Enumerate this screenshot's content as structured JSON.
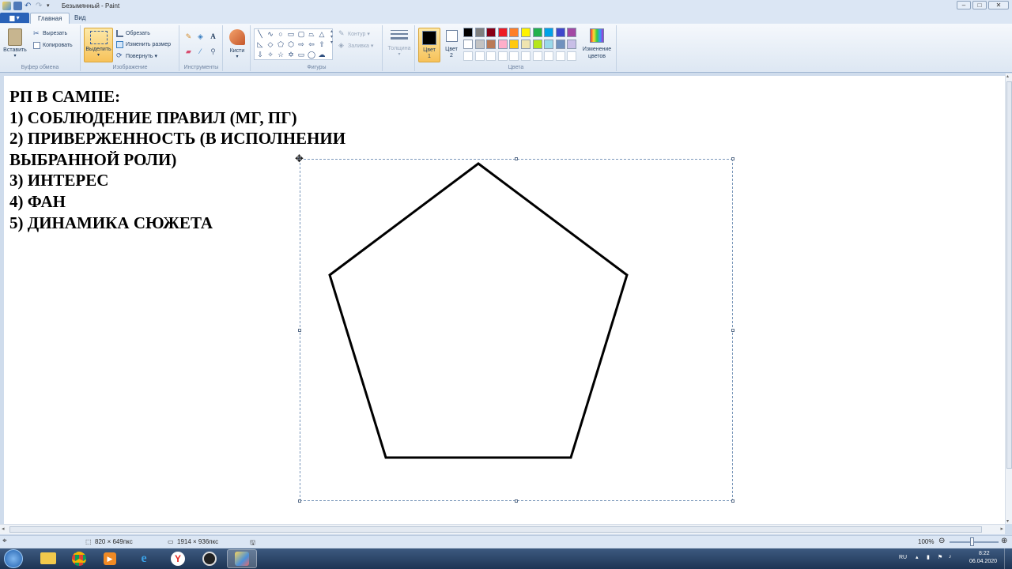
{
  "window": {
    "title": "Безымянный - Paint",
    "min": "–",
    "max": "□",
    "close": "✕"
  },
  "tabs": {
    "menu": "▆ ▾",
    "home": "Главная",
    "view": "Вид"
  },
  "clipboard": {
    "paste": "Вставить",
    "cut": "Вырезать",
    "copy": "Копировать",
    "label": "Буфер обмена"
  },
  "image": {
    "select": "Выделить",
    "crop": "Обрезать",
    "resize": "Изменить размер",
    "rotate": "Повернуть ▾",
    "label": "Изображение"
  },
  "tools": {
    "label": "Инструменты",
    "text_tool": "A"
  },
  "brushes": {
    "label": "Кисти"
  },
  "shapes": {
    "outline": "Контур ▾",
    "fill": "Заливка ▾",
    "label": "Фигуры"
  },
  "size": {
    "label": "Толщина"
  },
  "colors": {
    "color1": "Цвет 1",
    "color2": "Цвет 2",
    "edit": "Изменение цветов",
    "label": "Цвета",
    "color1_value": "#000000",
    "color2_value": "#ffffff",
    "palette_row1": [
      "#000000",
      "#7f7f7f",
      "#880015",
      "#ed1c24",
      "#ff7f27",
      "#fff200",
      "#22b14c",
      "#00a2e8",
      "#3f48cc",
      "#a349a4"
    ],
    "palette_row2": [
      "#ffffff",
      "#c3c3c3",
      "#b97a57",
      "#ffaec9",
      "#ffc90e",
      "#efe4b0",
      "#b5e61d",
      "#99d9ea",
      "#7092be",
      "#c8bfe7"
    ]
  },
  "canvas": {
    "text": "РП В САМПЕ:\n1) СОБЛЮДЕНИЕ ПРАВИЛ (МГ, ПГ)\n2) ПРИВЕРЖЕННОСТЬ (В ИСПОЛНЕНИИ\nВЫБРАННОЙ РОЛИ)\n3) ИНТЕРЕС\n4) ФАН\n5) ДИНАМИКА СЮЖЕТА"
  },
  "status": {
    "selection_size": "820 × 649пкс",
    "image_size": "1914 × 936пкс",
    "zoom": "100%"
  },
  "taskbar": {
    "lang": "RU",
    "time": "8:22",
    "date": "06.04.2020"
  }
}
